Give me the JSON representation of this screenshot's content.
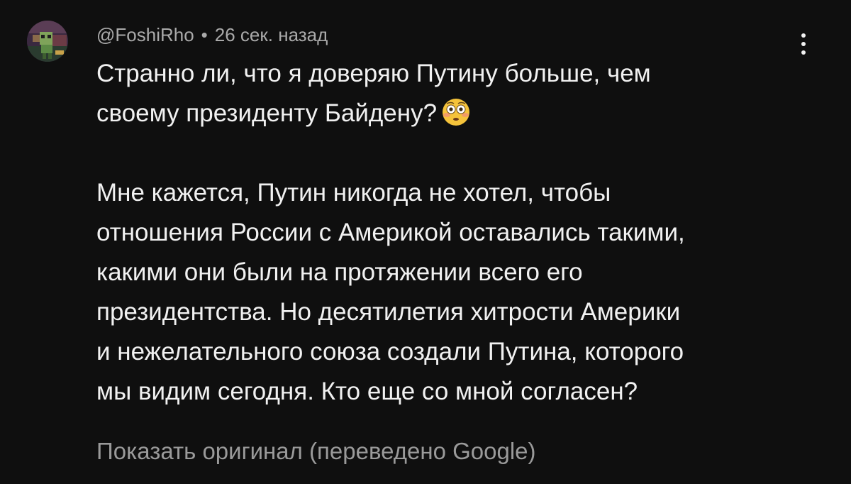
{
  "comment": {
    "author": "@FoshiRho",
    "separator": "•",
    "timestamp": "26 сек. назад",
    "avatar": "pixel-art-avatar",
    "menu_icon": "more-vertical-icon",
    "paragraph1_lines": [
      "Странно ли, что я доверяю Путину больше, чем",
      "своему президенту Байдену?"
    ],
    "emoji": "flushed-face-emoji",
    "paragraph2_lines": [
      "Мне кажется, Путин никогда не хотел, чтобы",
      "отношения России с Америкой оставались такими,",
      "какими они были на протяжении всего его",
      "президентства. Но десятилетия хитрости Америки",
      "и нежелательного союза создали Путина, которого",
      "мы видим сегодня. Кто еще со мной согласен?"
    ],
    "translate_link": "Показать оригинал (переведено Google)"
  },
  "colors": {
    "background": "#0f0f0f",
    "text": "#f1f1f1",
    "secondary_text": "#aaaaaa",
    "link_text": "#9a9a9a",
    "emoji_face": "#f5c33b"
  }
}
